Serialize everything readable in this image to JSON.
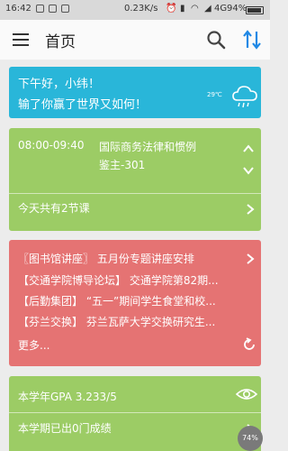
{
  "status_bar": {
    "time": "16:42",
    "net_speed": "0.23K/s",
    "network": "4G",
    "battery": "94%"
  },
  "app_bar": {
    "title": "首页",
    "icons": [
      "menu-icon",
      "search-icon",
      "sort-icon"
    ]
  },
  "weather": {
    "greeting": "下午好，小纬！",
    "quote": "输了你赢了世界又如何！",
    "temperature": "29℃",
    "icon": "cloud-rain-icon",
    "color": "#29b6d9"
  },
  "course": {
    "time": "08:00-09:40",
    "name": "国际商务法律和惯例",
    "room": "鉴主-301",
    "summary": "今天共有2节课",
    "color": "#9ccc65"
  },
  "news": {
    "items": [
      "〖图书馆讲座〗 五月份专题讲座安排",
      "【交通学院博导论坛】 交通学院第82期...",
      "【后勤集团】 “五一”期间学生食堂和校...",
      "【芬兰交换】 芬兰瓦萨大学交换研究生..."
    ],
    "more": "更多...",
    "color": "#e57373"
  },
  "gpa": {
    "label": "本学年GPA   3.233/5",
    "grades": "本学期已出0门成绩",
    "color": "#9ccc65"
  },
  "floating_badge": "74"
}
